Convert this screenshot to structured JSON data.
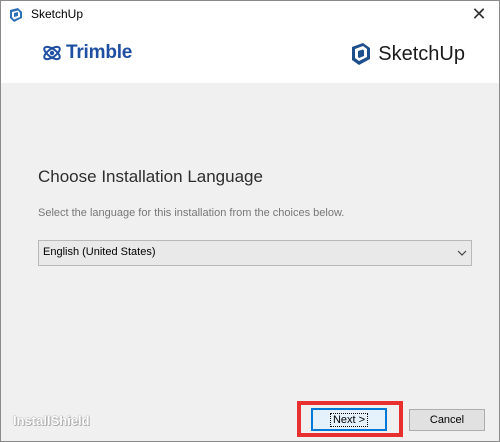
{
  "window": {
    "title": "SketchUp",
    "close_glyph": "✕"
  },
  "header": {
    "left_brand": "Trimble",
    "right_brand": "SketchUp"
  },
  "main": {
    "heading": "Choose Installation Language",
    "instruction": "Select the language for this installation from the choices below.",
    "language_select": {
      "selected": "English (United States)"
    }
  },
  "footer": {
    "installer_brand": "InstallShield",
    "next_label": "Next >",
    "cancel_label": "Cancel"
  },
  "colors": {
    "trimble_blue": "#1f4fa0",
    "content_bg": "#f0f0f0",
    "highlight": "#e8302f",
    "focus_blue": "#0078d7"
  },
  "icons": {
    "title_icon": "sketchup-app-icon",
    "trimble_icon": "trimble-globe-icon",
    "sketchup_icon": "sketchup-logo-icon",
    "dropdown_icon": "chevron-down-icon",
    "close_icon": "close-icon"
  }
}
